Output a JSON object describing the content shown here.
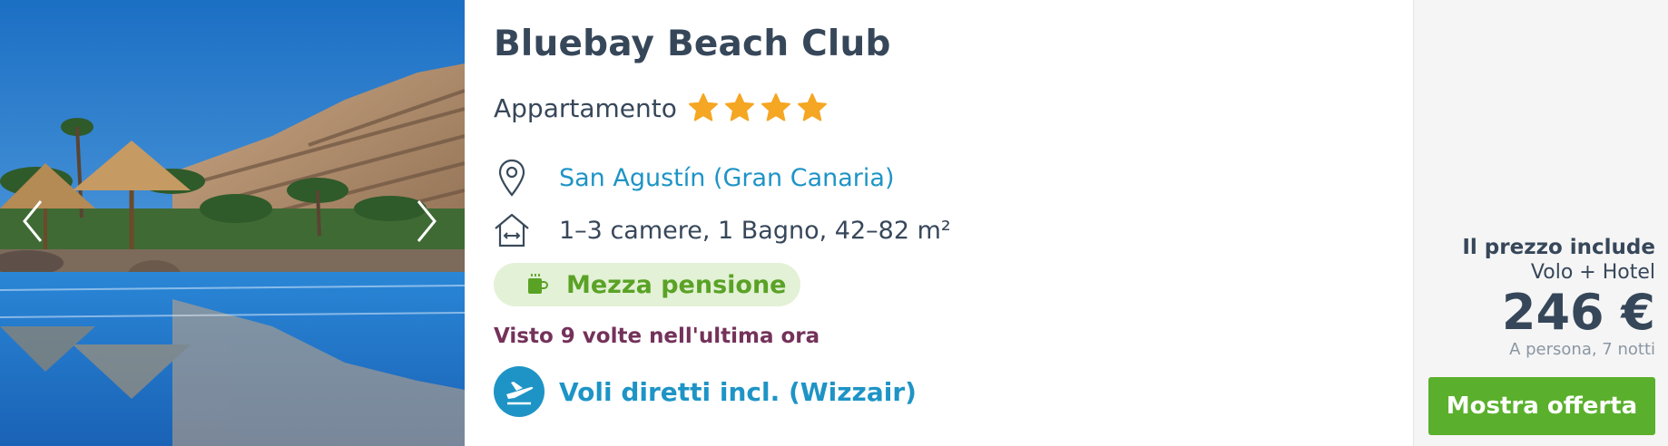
{
  "hotel": {
    "name": "Bluebay Beach Club",
    "type": "Appartamento",
    "stars": 4,
    "location": "San Agustín (Gran Canaria)",
    "rooms": "1–3 camere, 1 Bagno, 42–82 m²",
    "board": "Mezza pensione",
    "views": "Visto 9 volte nell'ultima ora",
    "flights": "Voli diretti incl. (Wizzair)"
  },
  "price": {
    "includes_title": "Il prezzo include",
    "includes_value": "Volo + Hotel",
    "amount": "246 €",
    "note": "A persona, 7 notti",
    "cta_label": "Mostra offerta"
  },
  "icons": {
    "gallery_prev": "chevron-left-icon",
    "gallery_next": "chevron-right-icon",
    "location": "map-pin-icon",
    "rooms": "house-size-icon",
    "board": "cup-icon",
    "flights": "airplane-icon",
    "star": "star-icon"
  },
  "colors": {
    "title": "#37475a",
    "link": "#1e94c6",
    "star": "#f5a623",
    "board_bg": "#e3f1d6",
    "board_text": "#5aa226",
    "views": "#74325a",
    "cta": "#5ab02c",
    "price_bg": "#f5f5f5"
  }
}
